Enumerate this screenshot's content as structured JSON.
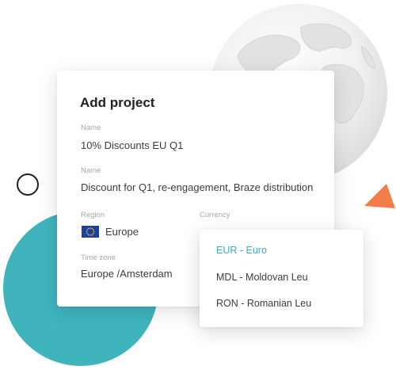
{
  "card": {
    "title": "Add project",
    "fields": [
      {
        "label": "Name",
        "value": "10% Discounts EU Q1"
      },
      {
        "label": "Name",
        "value": "Discount for Q1, re-engagement, Braze distribution"
      },
      {
        "label": "Region",
        "value": "Europe"
      },
      {
        "label": "Currency",
        "value": ""
      },
      {
        "label": "Time zone",
        "value": "Europe /Amsterdam"
      }
    ],
    "region_flag_icon": "eu-flag-icon"
  },
  "currency_dropdown": {
    "options": [
      {
        "label": "EUR - Euro",
        "selected": true
      },
      {
        "label": "MDL - Moldovan Leu",
        "selected": false
      },
      {
        "label": "RON - Romanian Leu",
        "selected": false
      }
    ]
  },
  "colors": {
    "accent": "#3aadb8",
    "teal_circle": "#3fb4bd",
    "orange_triangle": "#f47c48",
    "eu_blue": "#1f3f9c",
    "eu_star": "#f5d327"
  },
  "decorations": [
    "globe-illustration",
    "teal-circle",
    "ring-circle",
    "orange-triangle"
  ]
}
